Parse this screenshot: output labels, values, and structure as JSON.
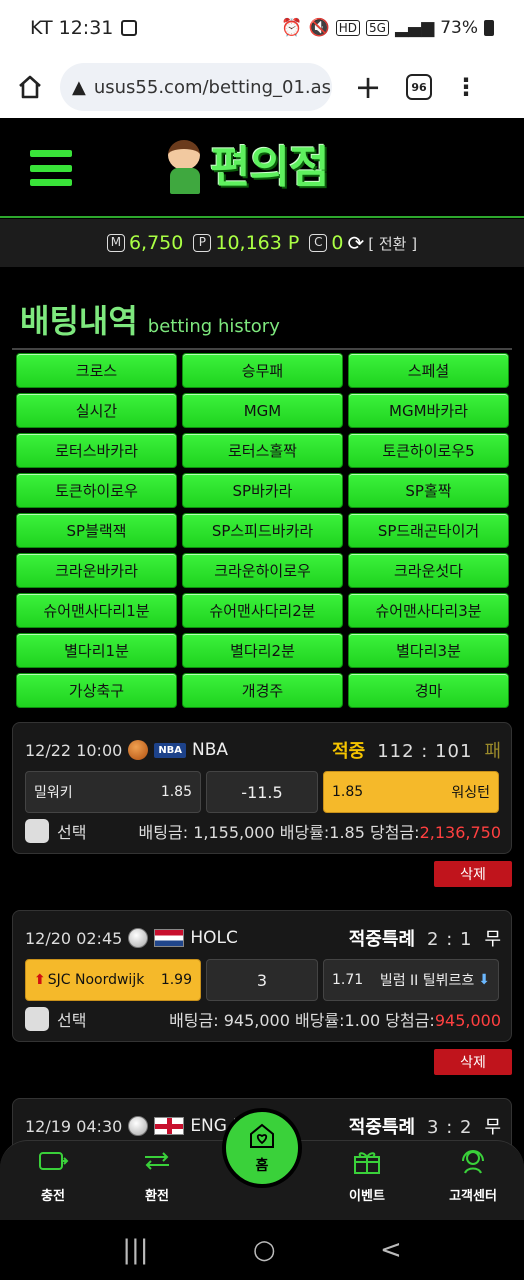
{
  "status_bar": {
    "carrier_time": "KT 12:31",
    "network": "5G",
    "hd": "HD",
    "battery": "73%"
  },
  "browser": {
    "url": "usus55.com/betting_01.asp",
    "tab_count": "96"
  },
  "site": {
    "logo_text": "편의점"
  },
  "points": {
    "m_badge": "M",
    "m_value": "6,750",
    "p_badge": "P",
    "p_value": "10,163 P",
    "c_badge": "C",
    "c_value": "0",
    "swap_label": "[ 전환 ]"
  },
  "section": {
    "title_ko": "배팅내역",
    "title_en": "betting history"
  },
  "categories": [
    "크로스",
    "승무패",
    "스페셜",
    "실시간",
    "MGM",
    "MGM바카라",
    "로터스바카라",
    "로터스홀짝",
    "토큰하이로우5",
    "토큰하이로우",
    "SP바카라",
    "SP홀짝",
    "SP블랙잭",
    "SP스피드바카라",
    "SP드래곤타이거",
    "크라운바카라",
    "크라운하이로우",
    "크라운섯다",
    "슈어맨사다리1분",
    "슈어맨사다리2분",
    "슈어맨사다리3분",
    "별다리1분",
    "별다리2분",
    "별다리3분",
    "가상축구",
    "개경주",
    "경마"
  ],
  "bets": [
    {
      "date": "12/22 10:00",
      "league_badge": "NBA",
      "league": "NBA",
      "status": "적중",
      "status_color": "#f5c400",
      "score": "112 : 101",
      "verdict": "패",
      "verdict_color": "#9a8a2a",
      "home_team": "밀워키",
      "home_odd": "1.85",
      "handicap": "-11.5",
      "away_odd": "1.85",
      "away_team": "워싱턴",
      "select_label": "선택",
      "stake_label": "배팅금:",
      "stake": "1,155,000",
      "rate_label": "배당률:",
      "rate": "1.85",
      "payout_label": "당첨금:",
      "payout": "2,136,750",
      "delete_label": "삭제"
    },
    {
      "date": "12/20 02:45",
      "league": "HOLC",
      "status": "적중특례",
      "status_color": "#ffffff",
      "score": "2 : 1",
      "verdict": "무",
      "verdict_color": "#ffffff",
      "home_team": "SJC Noordwijk",
      "home_odd": "1.99",
      "handicap": "3",
      "away_odd": "1.71",
      "away_team": "빌럼 II 틸뷔르흐",
      "select_label": "선택",
      "stake_label": "배팅금:",
      "stake": "945,000",
      "rate_label": "배당률:",
      "rate": "1.00",
      "payout_label": "당첨금:",
      "payout": "945,000",
      "delete_label": "삭제"
    },
    {
      "date": "12/19 04:30",
      "league": "ENG LC",
      "status": "적중특례",
      "score": "3 : 2",
      "verdict": "무"
    }
  ],
  "bottom_nav": {
    "charge": "충전",
    "exchange": "환전",
    "home": "홈",
    "event": "이벤트",
    "support": "고객센터"
  },
  "android_nav": {
    "recent": "|||",
    "home": "○",
    "back": "<"
  },
  "colors": {
    "accent_green": "#39e339",
    "selected_odd": "#f5b92a",
    "delete_red": "#c0141c",
    "payout_red": "#ff4040"
  }
}
